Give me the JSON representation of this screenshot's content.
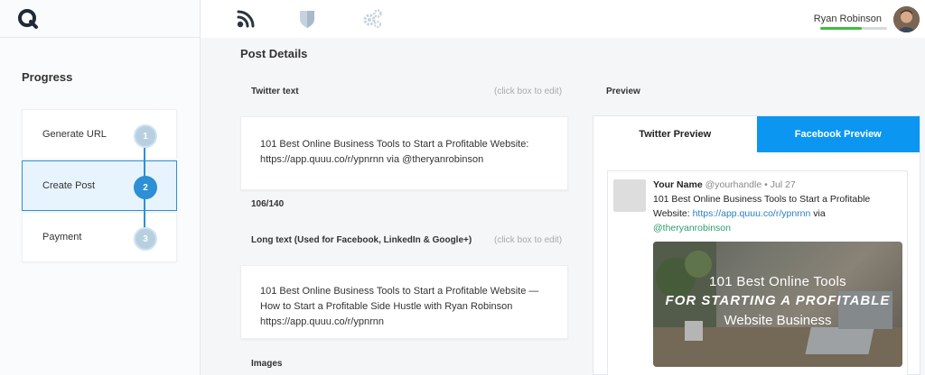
{
  "sidebar": {
    "logo_letter": "Q",
    "progress_title": "Progress",
    "steps": [
      {
        "label": "Generate URL",
        "number": "1"
      },
      {
        "label": "Create Post",
        "number": "2"
      },
      {
        "label": "Payment",
        "number": "3"
      }
    ]
  },
  "topbar": {
    "user_name": "Ryan Robinson",
    "progress_fraction": 0.62
  },
  "main": {
    "title": "Post Details",
    "twitter_label": "Twitter text",
    "twitter_hint": "(click box to edit)",
    "twitter_text": "101 Best Online Business Tools to Start a Profitable Website: https://app.quuu.co/r/ypnrnn via @theryanrobinson",
    "char_count": "106/140",
    "long_label": "Long text (Used for Facebook, LinkedIn & Google+)",
    "long_hint": "(click box to edit)",
    "long_text": "101 Best Online Business Tools to Start a Profitable Website — How to Start a Profitable Side Hustle with Ryan Robinson https://app.quuu.co/r/ypnrnn",
    "images_label": "Images"
  },
  "preview": {
    "label": "Preview",
    "tab_twitter": "Twitter Preview",
    "tab_facebook": "Facebook Preview",
    "tweet": {
      "name": "Your Name",
      "handle": "@yourhandle",
      "date": "• Jul 27",
      "text": "101 Best Online Business Tools to Start a Profitable Website:",
      "link": "https://app.quuu.co/r/ypnrnn",
      "via": "via",
      "mention": "@theryanrobinson",
      "image_line1": "101 Best Online Tools",
      "image_line2": "for starting a profitable",
      "image_line3": "Website Business"
    }
  },
  "colors": {
    "accent": "#2d8fd5",
    "facebook_tab": "#0b96f2",
    "progress_green": "#3fbf3f"
  }
}
